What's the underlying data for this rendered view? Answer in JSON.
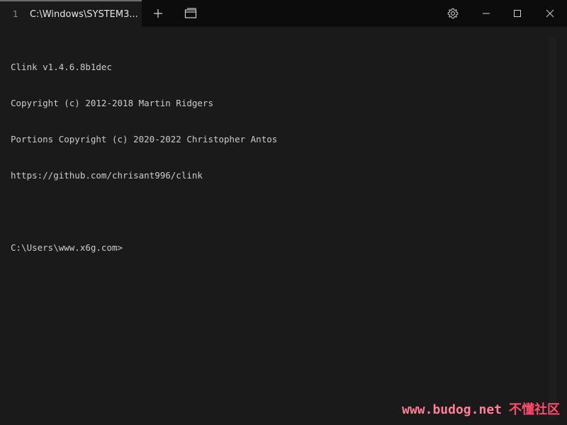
{
  "tab": {
    "index": "1",
    "title": "C:\\Windows\\SYSTEM3..."
  },
  "icons": {
    "new_tab": "plus-icon",
    "tab_menu": "tab-switcher-icon",
    "settings": "gear-icon",
    "minimize": "minimize-icon",
    "maximize": "maximize-icon",
    "close": "close-icon"
  },
  "terminal": {
    "lines": [
      "Clink v1.4.6.8b1dec",
      "Copyright (c) 2012-2018 Martin Ridgers",
      "Portions Copyright (c) 2020-2022 Christopher Antos",
      "https://github.com/chrisant996/clink",
      "",
      "C:\\Users\\www.x6g.com>"
    ]
  },
  "watermark": {
    "site": "www.budog.net",
    "cn": "不懂社区"
  },
  "colors": {
    "background": "#1a1a1a",
    "titlebar": "#0c0c0c",
    "text": "#cccccc",
    "watermark_site": "#ff7f96",
    "watermark_cn": "#ff4a6b"
  }
}
